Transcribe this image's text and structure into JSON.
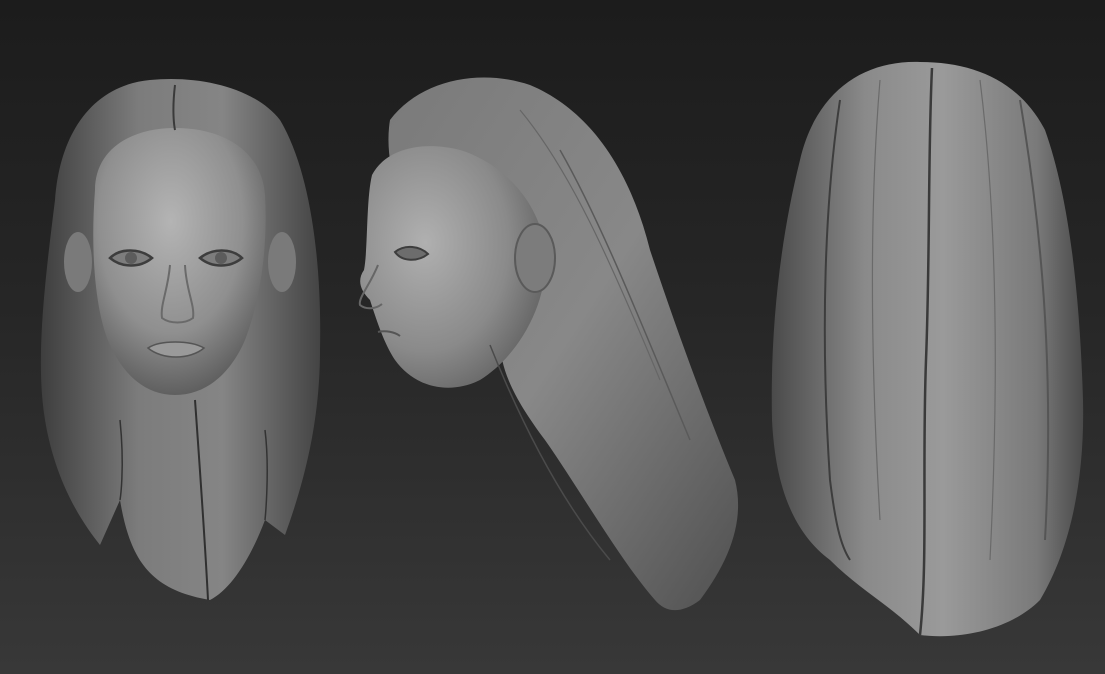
{
  "scene": {
    "description_items": [
      "front-view",
      "side-view",
      "back-view"
    ],
    "background_top": "#1c1c1c",
    "background_bottom": "#383838",
    "clay_color": "#8a8a8a"
  }
}
